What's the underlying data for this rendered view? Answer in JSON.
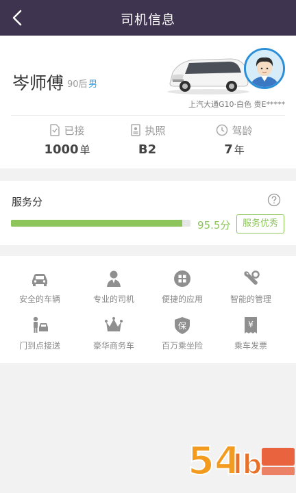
{
  "header": {
    "title": "司机信息",
    "back_icon": "back-arrow-icon"
  },
  "driver": {
    "name": "岑师傅",
    "age": "90后",
    "gender": "男",
    "car_info": "上汽大通G10·白色  贵E*****"
  },
  "stats": [
    {
      "icon": "order-icon",
      "label": "已接",
      "value": "1000",
      "unit": "单"
    },
    {
      "icon": "license-icon",
      "label": "执照",
      "value": "B2",
      "unit": ""
    },
    {
      "icon": "clock-icon",
      "label": "驾龄",
      "value": "7",
      "unit": "年"
    }
  ],
  "score": {
    "title": "服务分",
    "value_text": "95.5分",
    "value": 95.5,
    "max": 100,
    "badge": "服务优秀",
    "color": "#8dc55a"
  },
  "features": [
    {
      "icon": "car-icon",
      "label": "安全的车辆"
    },
    {
      "icon": "driver-icon",
      "label": "专业的司机"
    },
    {
      "icon": "apps-icon",
      "label": "便捷的应用"
    },
    {
      "icon": "wrench-icon",
      "label": "智能的管理"
    },
    {
      "icon": "person-car-icon",
      "label": "门到点接送"
    },
    {
      "icon": "crown-icon",
      "label": "豪华商务车"
    },
    {
      "icon": "shield-icon",
      "label": "百万乘坐险"
    },
    {
      "icon": "invoice-icon",
      "label": "乘车发票"
    }
  ],
  "colors": {
    "header_bg": "#3f3450",
    "accent": "#8dc55a",
    "gender": "#3b9fd8"
  }
}
